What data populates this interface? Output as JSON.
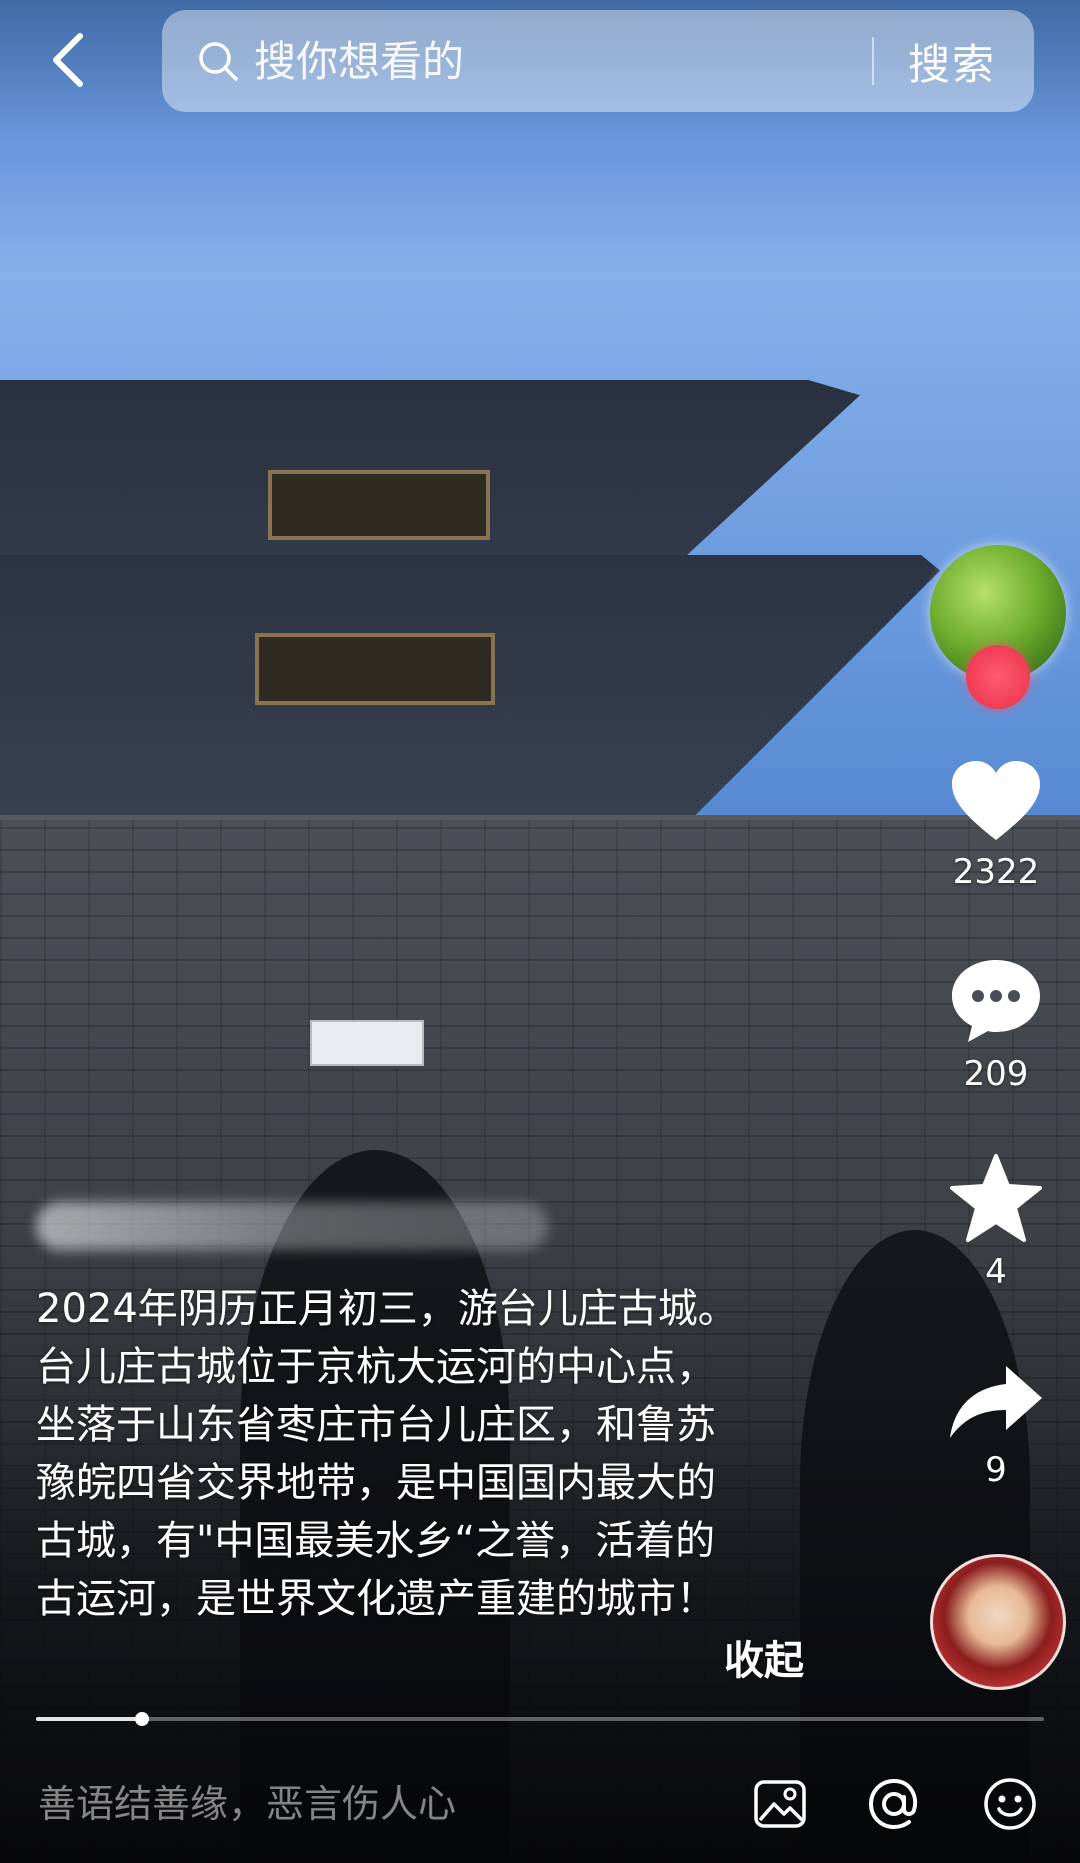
{
  "search": {
    "placeholder": "搜你想看的",
    "button_label": "搜索"
  },
  "icons": {
    "back": "chevron-left-icon",
    "search": "search-icon",
    "like": "heart-icon",
    "comment": "comment-bubble-icon",
    "favorite": "star-icon",
    "share": "share-arrow-icon",
    "image": "image-icon",
    "mention": "at-icon",
    "emoji": "smiley-icon"
  },
  "actions": {
    "like_count": "2322",
    "comment_count": "209",
    "favorite_count": "4",
    "share_count": "9"
  },
  "caption": {
    "text": "2024年阴历正月初三，游台儿庄古城。\n台儿庄古城位于京杭大运河的中心点，\n坐落于山东省枣庄市台儿庄区，和鲁苏\n豫皖四省交界地带，是中国国内最大的\n古城，有\"中国最美水乡“之誉，活着的\n古运河，是世界文化遗产重建的城市！",
    "collapse_label": "收起"
  },
  "progress": {
    "fraction": 0.105
  },
  "comment_bar": {
    "placeholder": "善语结善缘，恶言伤人心"
  },
  "colors": {
    "follow_dot": "#f03d55",
    "text": "#ffffff"
  }
}
